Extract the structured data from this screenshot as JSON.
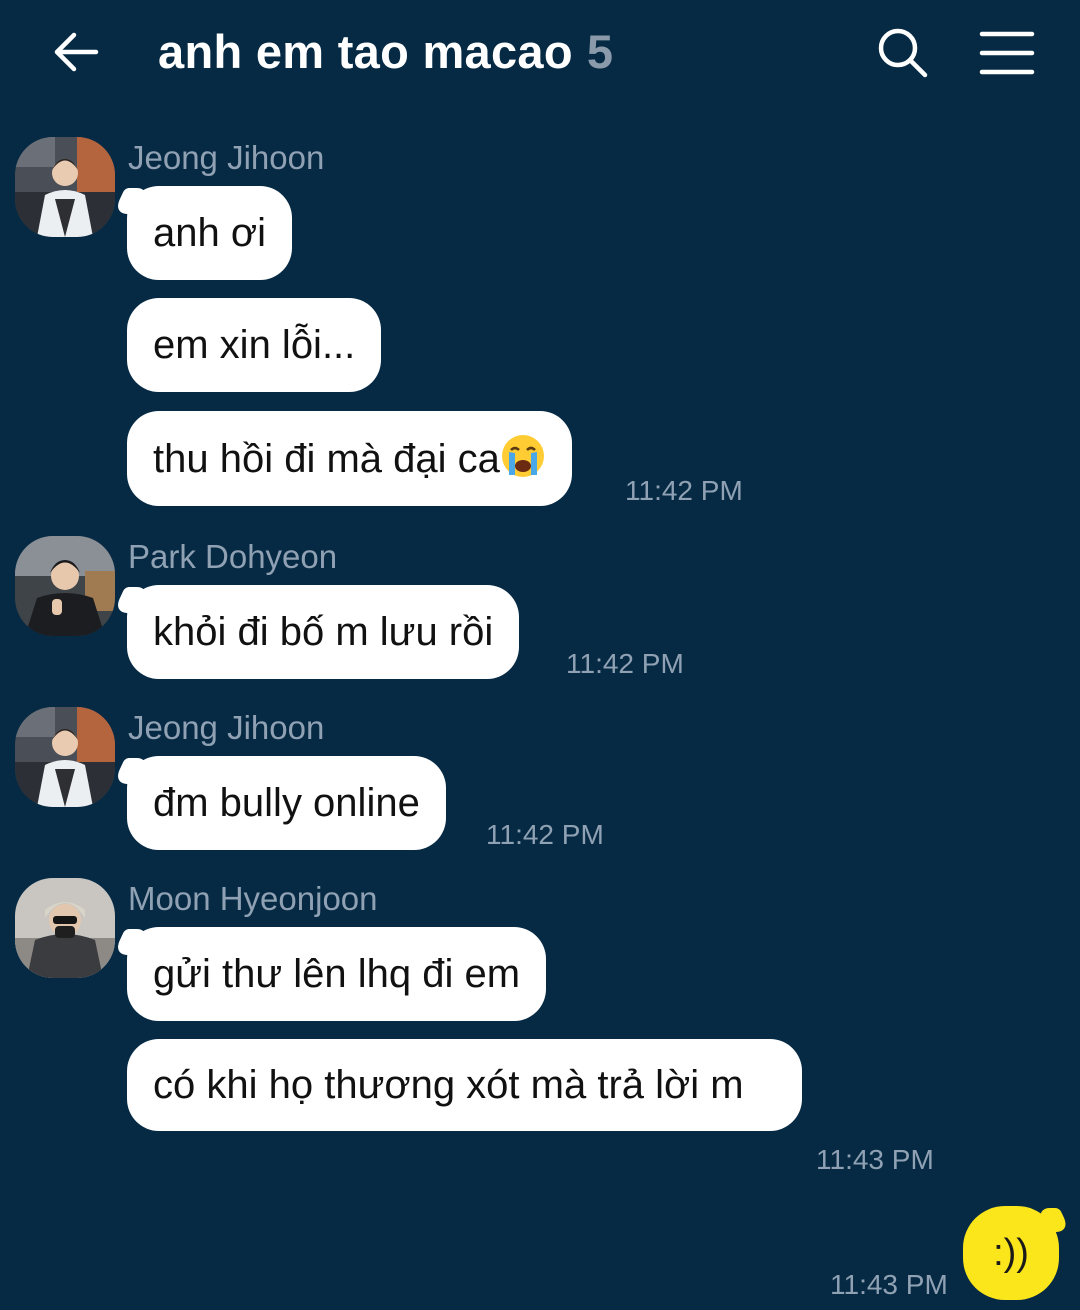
{
  "header": {
    "title": "anh em tao macao",
    "member_count": "5",
    "icons": [
      "back-arrow-icon",
      "search-icon",
      "menu-icon"
    ]
  },
  "messages": [
    {
      "sender": "Jeong Jihoon",
      "avatar": "player-photo-avatar",
      "texts": [
        "anh ơi",
        "em xin lỗi...",
        "thu hồi đi mà đại ca"
      ],
      "last_emoji": "crying-face-emoji",
      "time": "11:42 PM"
    },
    {
      "sender": "Park Dohyeon",
      "avatar": "player-photo-avatar",
      "texts": [
        "khỏi đi bố m lưu rồi"
      ],
      "time": "11:42 PM"
    },
    {
      "sender": "Jeong Jihoon",
      "avatar": "player-photo-avatar",
      "texts": [
        "đm bully online"
      ],
      "time": "11:42 PM"
    },
    {
      "sender": "Moon Hyeonjoon",
      "avatar": "player-photo-avatar",
      "texts": [
        "gửi thư lên lhq đi em",
        "có khi họ thương xót mà trả lời m"
      ],
      "time": "11:43 PM"
    }
  ],
  "my_message": {
    "text": ":))",
    "time": "11:43 PM"
  },
  "colors": {
    "background": "#062a44",
    "bubble_other": "#ffffff",
    "bubble_mine": "#fbe51b",
    "meta_text": "#8fa1b3"
  }
}
